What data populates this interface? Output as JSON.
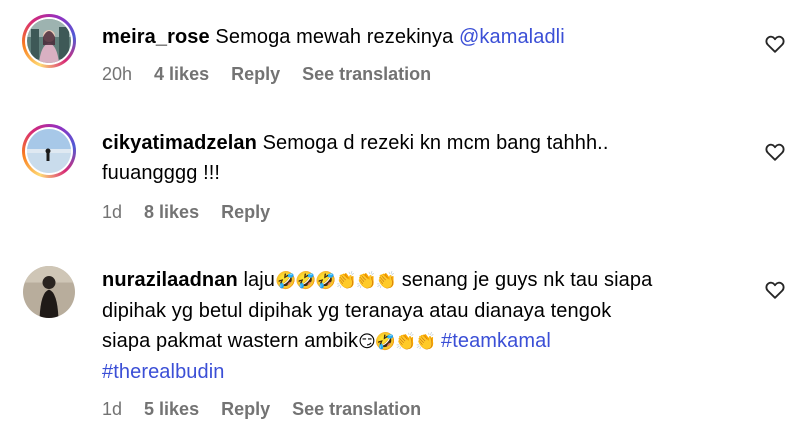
{
  "comments": [
    {
      "username": "meira_rose",
      "text": "Semoga mewah rezekinya",
      "mention": "@kamaladli",
      "time": "20h",
      "likes": "4 likes",
      "reply": "Reply",
      "translate": "See translation"
    },
    {
      "username": "cikyatimadzelan",
      "text_line1": "Semoga d rezeki kn mcm bang tahhh..",
      "text_line2": "fuuangggg !!!",
      "time": "1d",
      "likes": "8 likes",
      "reply": "Reply"
    },
    {
      "username": "nurazilaadnan",
      "text_a": "laju",
      "emoji_a": "🤣🤣🤣👏👏👏",
      "text_b": "senang je guys nk tau siapa",
      "text_line2": "dipihak yg betul dipihak yg teranaya atau dianaya tengok",
      "text_line3": "siapa pakmat wastern ambik",
      "emoji_b": "😏🤣👏👏",
      "hashtag1": "#teamkamal",
      "hashtag2": "#therealbudin",
      "time": "1d",
      "likes": "5 likes",
      "reply": "Reply",
      "translate": "See translation"
    }
  ],
  "icons": {
    "like": "heart-outline-icon"
  },
  "colors": {
    "link": "#3b4fd6",
    "meta": "#737373"
  }
}
